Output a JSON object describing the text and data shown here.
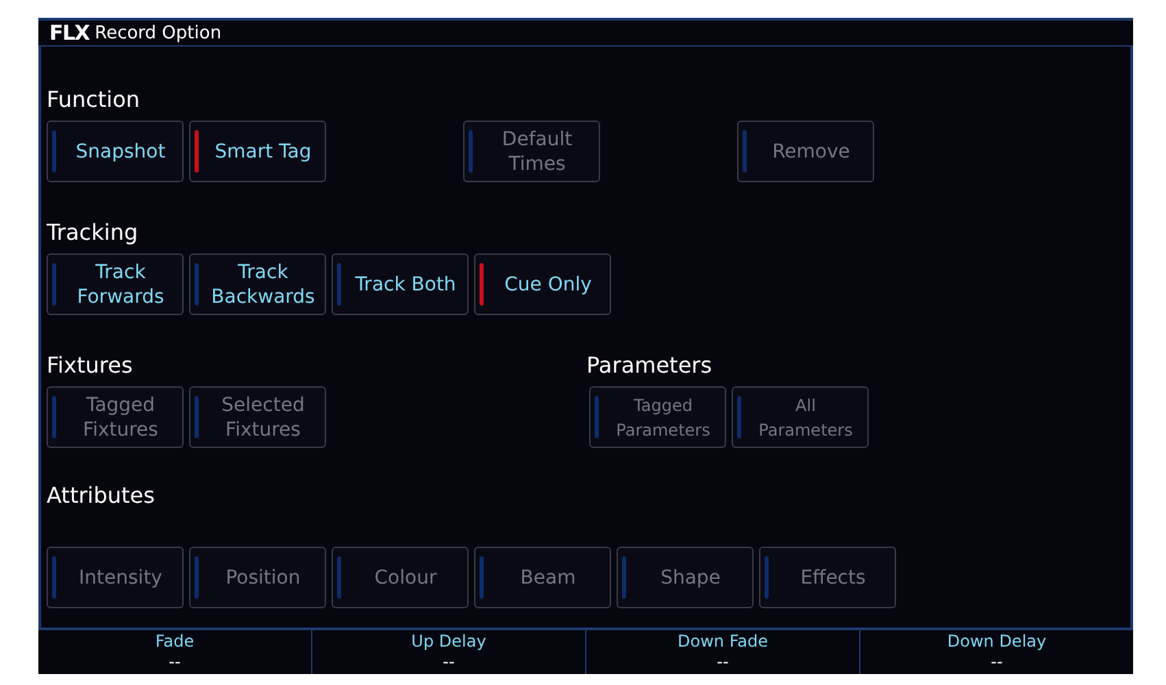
{
  "window": {
    "logo": "FLX",
    "title": "Record Option"
  },
  "rows": [
    {
      "groups": [
        {
          "title": "Function",
          "buttons": [
            {
              "label": "Snapshot",
              "selected": false,
              "disabled": false
            },
            {
              "label": "Smart Tag",
              "selected": true,
              "disabled": false
            },
            {
              "label": "Default Times",
              "selected": false,
              "disabled": true
            },
            {
              "label": "Remove",
              "selected": false,
              "disabled": true
            }
          ]
        }
      ]
    },
    {
      "groups": [
        {
          "title": "Tracking",
          "buttons": [
            {
              "label": "Track Forwards",
              "selected": false,
              "disabled": false
            },
            {
              "label": "Track Backwards",
              "selected": false,
              "disabled": false
            },
            {
              "label": "Track Both",
              "selected": false,
              "disabled": false
            },
            {
              "label": "Cue Only",
              "selected": true,
              "disabled": false
            }
          ]
        }
      ]
    },
    {
      "groups": [
        {
          "title": "Fixtures",
          "buttons": [
            {
              "label": "Tagged Fixtures",
              "selected": false,
              "disabled": true
            },
            {
              "label": "Selected Fixtures",
              "selected": false,
              "disabled": true
            }
          ]
        },
        {
          "title": "Parameters",
          "buttons": [
            {
              "label": "Tagged Parameters",
              "selected": false,
              "disabled": true
            },
            {
              "label": "All Parameters",
              "selected": false,
              "disabled": true
            }
          ]
        }
      ]
    },
    {
      "groups": [
        {
          "title": "Attributes",
          "buttons": [
            {
              "label": "Intensity",
              "selected": false,
              "disabled": true
            },
            {
              "label": "Position",
              "selected": false,
              "disabled": true
            },
            {
              "label": "Colour",
              "selected": false,
              "disabled": true
            },
            {
              "label": "Beam",
              "selected": false,
              "disabled": true
            },
            {
              "label": "Shape",
              "selected": false,
              "disabled": true
            },
            {
              "label": "Effects",
              "selected": false,
              "disabled": true
            }
          ]
        }
      ]
    }
  ],
  "status_bar": [
    {
      "label": "Fade",
      "value": "--"
    },
    {
      "label": "Up Delay",
      "value": "--"
    },
    {
      "label": "Down Fade",
      "value": "--"
    },
    {
      "label": "Down Delay",
      "value": "--"
    }
  ]
}
